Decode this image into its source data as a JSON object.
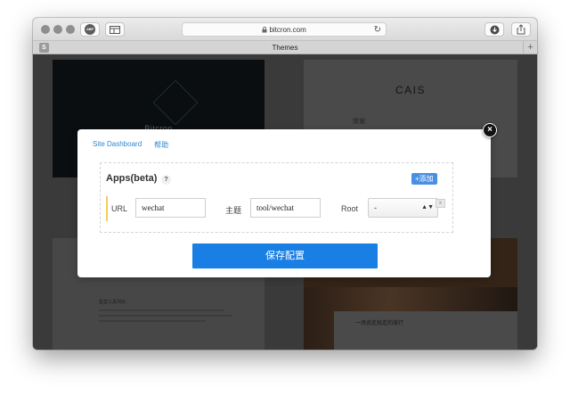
{
  "browser": {
    "address": "bitcron.com",
    "adblock_label": "ABP",
    "tab_badge": "S",
    "tab_title": "Themes",
    "new_tab_symbol": "+",
    "reload_symbol": "↻"
  },
  "background": {
    "card1_title": "Bitcron",
    "card2_title": "CAIS",
    "card2_sub": "致谢",
    "card3_title": "星型工具列出",
    "card4_title": "一场说走就走的旅行"
  },
  "modal": {
    "nav": [
      "Site Dashboard",
      "帮助"
    ],
    "apps_title": "Apps(beta)",
    "help_symbol": "?",
    "add_label": "+添加",
    "url_label": "URL",
    "url_value": "wechat",
    "theme_label": "主题",
    "theme_value": "tool/wechat",
    "root_label": "Root",
    "root_value": "-",
    "delete_symbol": "x",
    "save_label": "保存配置",
    "close_symbol": "×"
  },
  "colors": {
    "link": "#2c86d2",
    "primary_button": "#1a7fe5",
    "add_button": "#4a90e2",
    "accent_bar": "#f0d05a"
  }
}
